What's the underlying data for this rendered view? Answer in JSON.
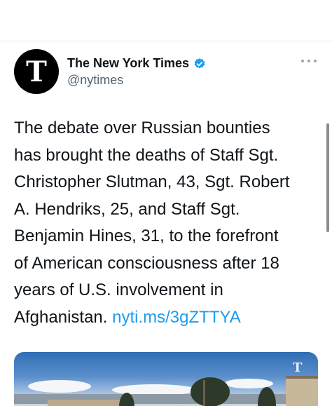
{
  "account": {
    "display_name": "The New York Times",
    "handle": "@nytimes",
    "avatar_glyph": "T",
    "verified": true
  },
  "tweet": {
    "text_lines": [
      "The debate over Russian bounties",
      "has brought the deaths of Staff Sgt.",
      "Christopher Slutman, 43, Sgt. Robert",
      "A. Hendriks, 25, and Staff Sgt.",
      "Benjamin Hines, 31, to the forefront",
      "of American consciousness after 18",
      "years of U.S. involvement in",
      "Afghanistan. "
    ],
    "link_text": "nyti.ms/3gZTTYA"
  },
  "media": {
    "watermark_glyph": "T"
  },
  "icons": {
    "verified": "verified-badge-icon",
    "more": "more-options-icon"
  },
  "colors": {
    "link": "#1d9bf0",
    "verified": "#1d9bf0",
    "secondary_text": "#536471"
  }
}
